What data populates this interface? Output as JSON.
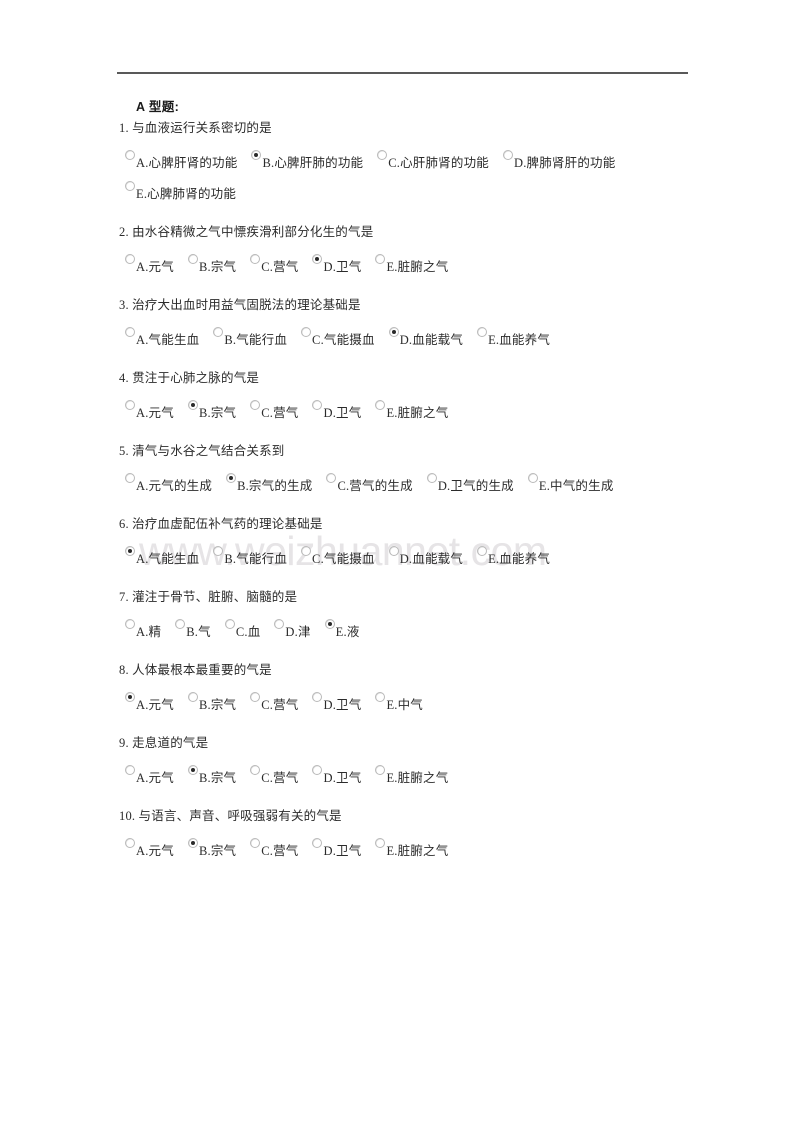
{
  "document": {
    "section_title": "A 型题:",
    "watermark": "www.weizhuannet.com"
  },
  "questions": [
    {
      "number": "1.",
      "stem": "1. 与血液运行关系密切的是",
      "options": [
        {
          "label": "A.心脾肝肾的功能",
          "selected": false
        },
        {
          "label": "B.心脾肝肺的功能",
          "selected": true
        },
        {
          "label": "C.心肝肺肾的功能",
          "selected": false
        },
        {
          "label": "D.脾肺肾肝的功能",
          "selected": false
        },
        {
          "label": "E.心脾肺肾的功能",
          "selected": false
        }
      ]
    },
    {
      "number": "2.",
      "stem": "2. 由水谷精微之气中慓疾滑利部分化生的气是",
      "options": [
        {
          "label": "A.元气",
          "selected": false
        },
        {
          "label": "B.宗气",
          "selected": false
        },
        {
          "label": "C.营气",
          "selected": false
        },
        {
          "label": "D.卫气",
          "selected": true
        },
        {
          "label": "E.脏腑之气",
          "selected": false
        }
      ]
    },
    {
      "number": "3.",
      "stem": "3. 治疗大出血时用益气固脱法的理论基础是",
      "options": [
        {
          "label": "A.气能生血",
          "selected": false
        },
        {
          "label": "B.气能行血",
          "selected": false
        },
        {
          "label": "C.气能摄血",
          "selected": false
        },
        {
          "label": "D.血能载气",
          "selected": true
        },
        {
          "label": "E.血能养气",
          "selected": false
        }
      ]
    },
    {
      "number": "4.",
      "stem": "4. 贯注于心肺之脉的气是",
      "options": [
        {
          "label": "A.元气",
          "selected": false
        },
        {
          "label": "B.宗气",
          "selected": true
        },
        {
          "label": "C.营气",
          "selected": false
        },
        {
          "label": "D.卫气",
          "selected": false
        },
        {
          "label": "E.脏腑之气",
          "selected": false
        }
      ]
    },
    {
      "number": "5.",
      "stem": "5. 清气与水谷之气结合关系到",
      "options": [
        {
          "label": "A.元气的生成",
          "selected": false
        },
        {
          "label": "B.宗气的生成",
          "selected": true
        },
        {
          "label": "C.营气的生成",
          "selected": false
        },
        {
          "label": "D.卫气的生成",
          "selected": false
        },
        {
          "label": "E.中气的生成",
          "selected": false
        }
      ]
    },
    {
      "number": "6.",
      "stem": "6. 治疗血虚配伍补气药的理论基础是",
      "options": [
        {
          "label": "A.气能生血",
          "selected": true
        },
        {
          "label": "B.气能行血",
          "selected": false
        },
        {
          "label": "C.气能摄血",
          "selected": false
        },
        {
          "label": "D.血能载气",
          "selected": false
        },
        {
          "label": "E.血能养气",
          "selected": false
        }
      ]
    },
    {
      "number": "7.",
      "stem": "7. 灌注于骨节、脏腑、脑髓的是",
      "options": [
        {
          "label": "A.精",
          "selected": false
        },
        {
          "label": "B.气",
          "selected": false
        },
        {
          "label": "C.血",
          "selected": false
        },
        {
          "label": "D.津",
          "selected": false
        },
        {
          "label": "E.液",
          "selected": true
        }
      ]
    },
    {
      "number": "8.",
      "stem": "8. 人体最根本最重要的气是",
      "options": [
        {
          "label": "A.元气",
          "selected": true
        },
        {
          "label": "B.宗气",
          "selected": false
        },
        {
          "label": "C.营气",
          "selected": false
        },
        {
          "label": "D.卫气",
          "selected": false
        },
        {
          "label": "E.中气",
          "selected": false
        }
      ]
    },
    {
      "number": "9.",
      "stem": "9. 走息道的气是",
      "options": [
        {
          "label": "A.元气",
          "selected": false
        },
        {
          "label": "B.宗气",
          "selected": true
        },
        {
          "label": "C.营气",
          "selected": false
        },
        {
          "label": "D.卫气",
          "selected": false
        },
        {
          "label": "E.脏腑之气",
          "selected": false
        }
      ]
    },
    {
      "number": "10.",
      "stem": "10. 与语言、声音、呼吸强弱有关的气是",
      "options": [
        {
          "label": "A.元气",
          "selected": false
        },
        {
          "label": "B.宗气",
          "selected": true
        },
        {
          "label": "C.营气",
          "selected": false
        },
        {
          "label": "D.卫气",
          "selected": false
        },
        {
          "label": "E.脏腑之气",
          "selected": false
        }
      ]
    }
  ]
}
